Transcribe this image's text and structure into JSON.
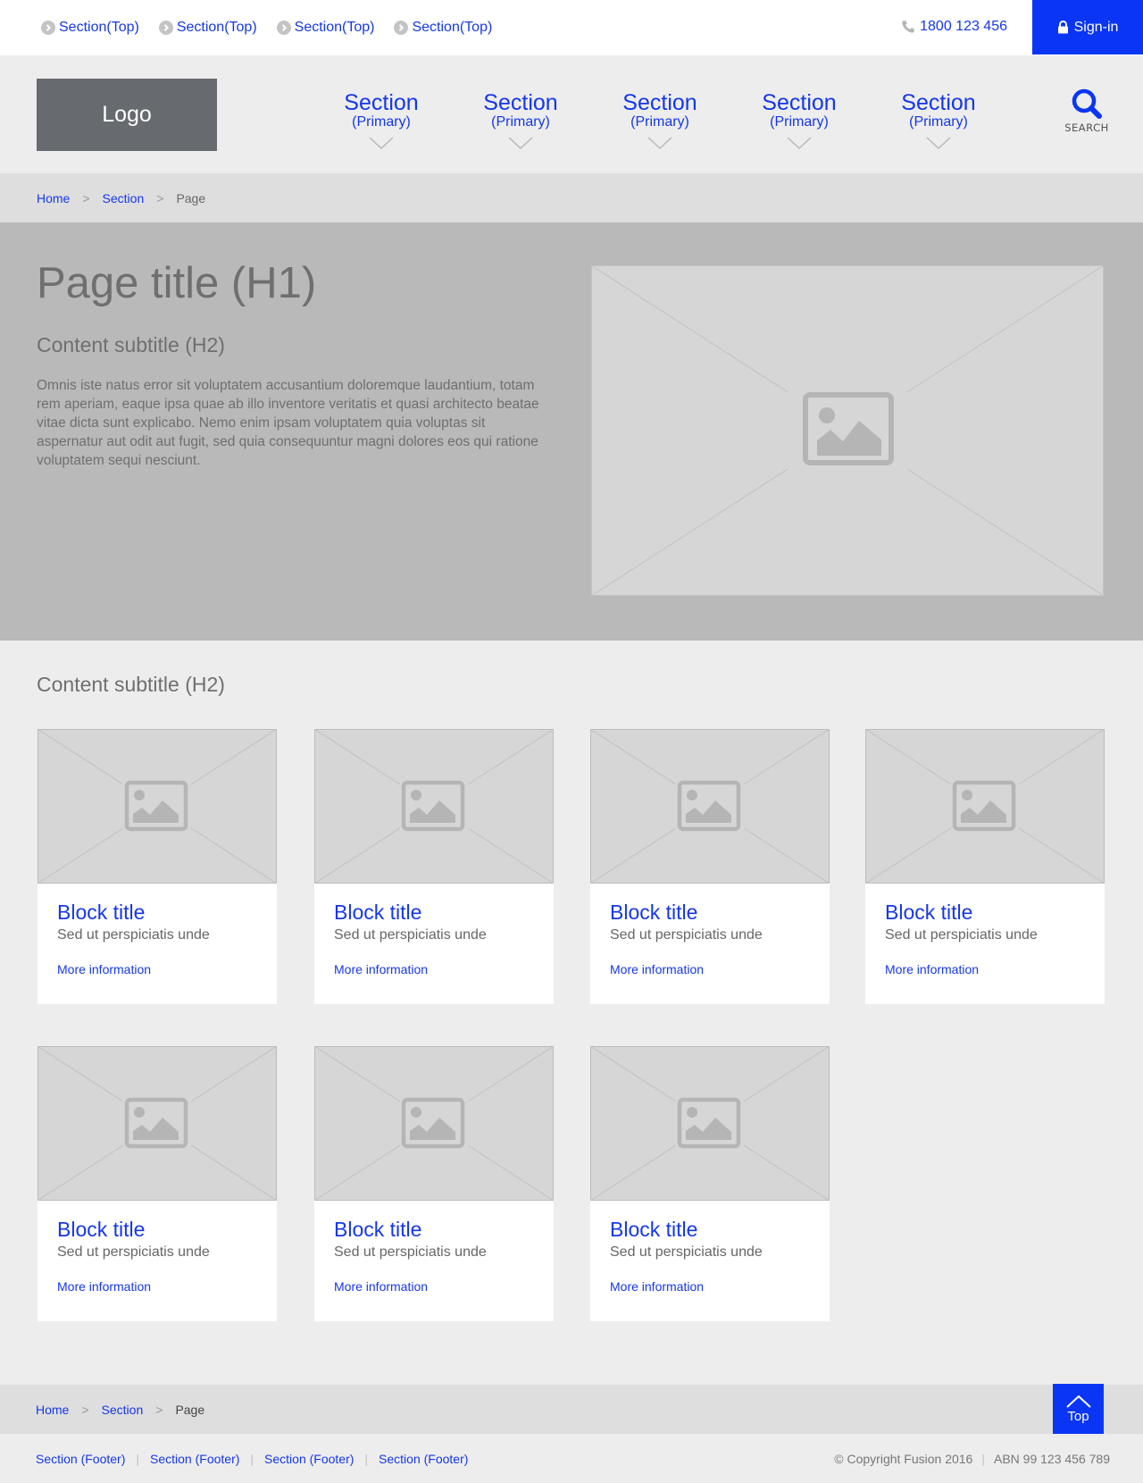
{
  "top_bar": {
    "links": [
      "Section(Top)",
      "Section(Top)",
      "Section(Top)",
      "Section(Top)"
    ],
    "phone": "1800 123 456",
    "signin_label": "Sign-in"
  },
  "header": {
    "logo": "Logo",
    "nav": [
      {
        "label": "Section",
        "sub": "(Primary)"
      },
      {
        "label": "Section",
        "sub": "(Primary)"
      },
      {
        "label": "Section",
        "sub": "(Primary)"
      },
      {
        "label": "Section",
        "sub": "(Primary)"
      },
      {
        "label": "Section",
        "sub": "(Primary)"
      }
    ],
    "search_label": "SEARCH"
  },
  "breadcrumb": {
    "home": "Home",
    "separator": ">",
    "section": "Section",
    "page": "Page"
  },
  "hero": {
    "title": "Page title (H1)",
    "subtitle": "Content subtitle (H2)",
    "body": "Omnis iste natus error sit voluptatem accusantium doloremque laudantium, totam rem aperiam, eaque ipsa quae ab illo inventore veritatis et quasi architecto beatae vitae dicta sunt explicabo. Nemo enim ipsam voluptatem quia voluptas sit aspernatur aut odit aut fugit, sed quia consequuntur magni dolores eos qui ratione voluptatem sequi nesciunt."
  },
  "content": {
    "subtitle": "Content subtitle (H2)",
    "cards": [
      {
        "title": "Block title",
        "text": "Sed ut perspiciatis unde",
        "link": "More information"
      },
      {
        "title": "Block title",
        "text": "Sed ut perspiciatis unde",
        "link": "More information"
      },
      {
        "title": "Block title",
        "text": "Sed ut perspiciatis unde",
        "link": "More information"
      },
      {
        "title": "Block title",
        "text": "Sed ut perspiciatis unde",
        "link": "More information"
      },
      {
        "title": "Block title",
        "text": "Sed ut perspiciatis unde",
        "link": "More information"
      },
      {
        "title": "Block title",
        "text": "Sed ut perspiciatis unde",
        "link": "More information"
      },
      {
        "title": "Block title",
        "text": "Sed ut perspiciatis unde",
        "link": "More information"
      }
    ]
  },
  "footer": {
    "back_to_top": "Top",
    "links": [
      "Section (Footer)",
      "Section (Footer)",
      "Section (Footer)",
      "Section (Footer)"
    ],
    "copyright": "© Copyright Fusion 2016",
    "abn": "ABN 99 123 456 789",
    "separator": "|"
  },
  "colors": {
    "accent": "#0a35f5",
    "link": "#1537e8",
    "hero_bg": "#b9b9b9",
    "logo_bg": "#676b70"
  },
  "icons": [
    "chevron-right-circle-icon",
    "phone-icon",
    "lock-icon",
    "chevron-down-icon",
    "search-icon",
    "image-placeholder-icon",
    "chevron-up-icon"
  ]
}
